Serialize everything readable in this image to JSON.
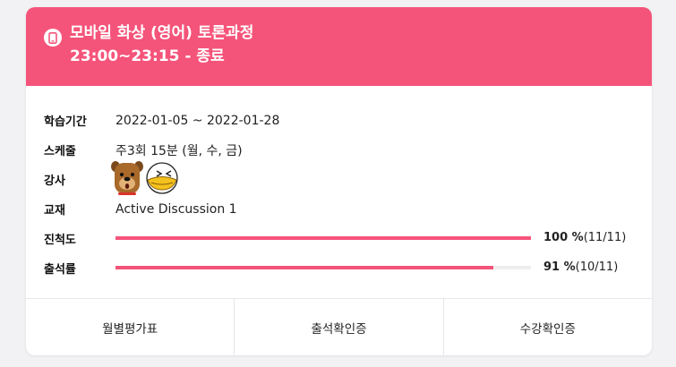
{
  "header": {
    "title": "모바일 화상 (영어) 토론과정",
    "subtitle": "23:00~23:15 - 종료",
    "icon": "mobile-phone-icon",
    "color": "#f5547a"
  },
  "info": {
    "period": {
      "label": "학습기간",
      "value": "2022-01-05 ~ 2022-01-28"
    },
    "schedule": {
      "label": "스케줄",
      "value": "주3회 15분 (월, 수, 금)"
    },
    "teacher": {
      "label": "강사",
      "avatars": [
        "dog-character-avatar",
        "chick-character-avatar"
      ]
    },
    "textbook": {
      "label": "교재",
      "value": "Active Discussion 1"
    },
    "progress": {
      "label": "진척도",
      "percent_text": "100 %",
      "count_text": "(11/11)",
      "fraction": 1.0
    },
    "attendance": {
      "label": "출석률",
      "percent_text": "91 %",
      "count_text": "(10/11)",
      "fraction": 0.91
    }
  },
  "footer": {
    "buttons": [
      "월별평가표",
      "출석확인증",
      "수강확인증"
    ]
  }
}
